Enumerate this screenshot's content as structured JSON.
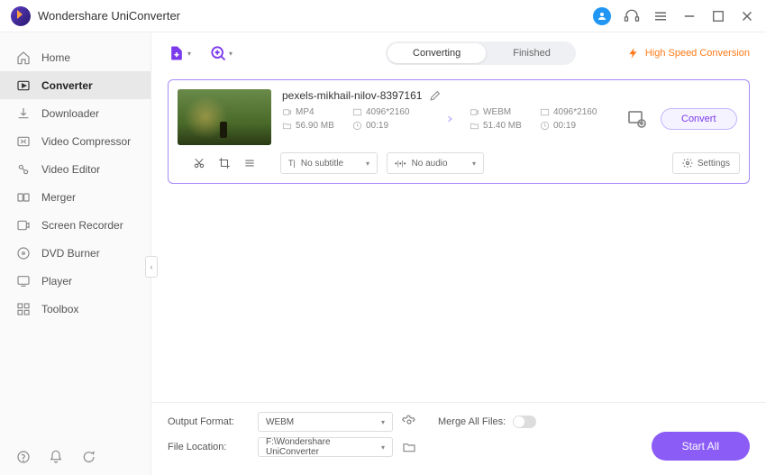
{
  "app": {
    "title": "Wondershare UniConverter"
  },
  "sidebar": {
    "items": [
      {
        "label": "Home"
      },
      {
        "label": "Converter"
      },
      {
        "label": "Downloader"
      },
      {
        "label": "Video Compressor"
      },
      {
        "label": "Video Editor"
      },
      {
        "label": "Merger"
      },
      {
        "label": "Screen Recorder"
      },
      {
        "label": "DVD Burner"
      },
      {
        "label": "Player"
      },
      {
        "label": "Toolbox"
      }
    ]
  },
  "tabs": {
    "converting": "Converting",
    "finished": "Finished"
  },
  "hsc": "High Speed Conversion",
  "file": {
    "name": "pexels-mikhail-nilov-8397161",
    "src": {
      "format": "MP4",
      "resolution": "4096*2160",
      "size": "56.90 MB",
      "duration": "00:19"
    },
    "dst": {
      "format": "WEBM",
      "resolution": "4096*2160",
      "size": "51.40 MB",
      "duration": "00:19"
    },
    "subtitle": "No subtitle",
    "audio": "No audio",
    "settings": "Settings",
    "convert": "Convert"
  },
  "footer": {
    "outputFormatLabel": "Output Format:",
    "outputFormat": "WEBM",
    "fileLocationLabel": "File Location:",
    "fileLocation": "F:\\Wondershare UniConverter",
    "mergeLabel": "Merge All Files:",
    "startAll": "Start All"
  }
}
